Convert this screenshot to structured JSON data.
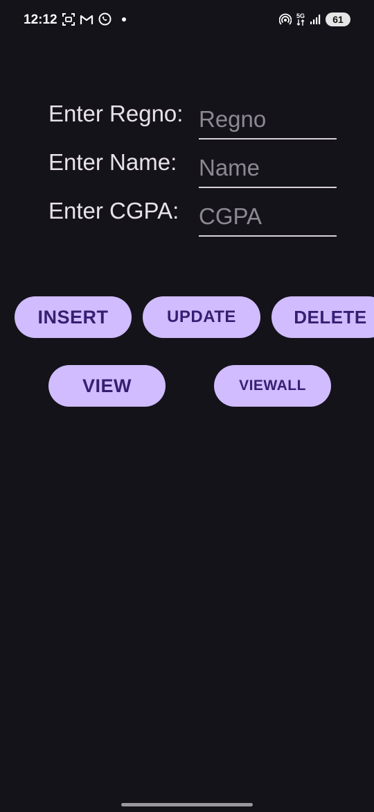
{
  "status_bar": {
    "time": "12:12",
    "left_icons": [
      "screenshot-icon",
      "gmail-icon",
      "whatsapp-icon",
      "notification-dot-icon"
    ],
    "right_icons": [
      "hotspot-icon",
      "5g-data-icon",
      "signal-icon"
    ],
    "network_label": "5G",
    "battery_level": "61"
  },
  "form": {
    "rows": [
      {
        "label": "Enter Regno:",
        "placeholder": "Regno"
      },
      {
        "label": "Enter Name:",
        "placeholder": "Name"
      },
      {
        "label": "Enter CGPA:",
        "placeholder": "CGPA"
      }
    ]
  },
  "buttons": {
    "insert": "INSERT",
    "update": "UPDATE",
    "delete": "DELETE",
    "view": "VIEW",
    "viewall": "VIEWALL"
  },
  "colors": {
    "background": "#15131a",
    "button_bg": "#d0bcfe",
    "button_text": "#381e72",
    "label_text": "#e8e2ea",
    "placeholder_text": "#8d8893"
  }
}
